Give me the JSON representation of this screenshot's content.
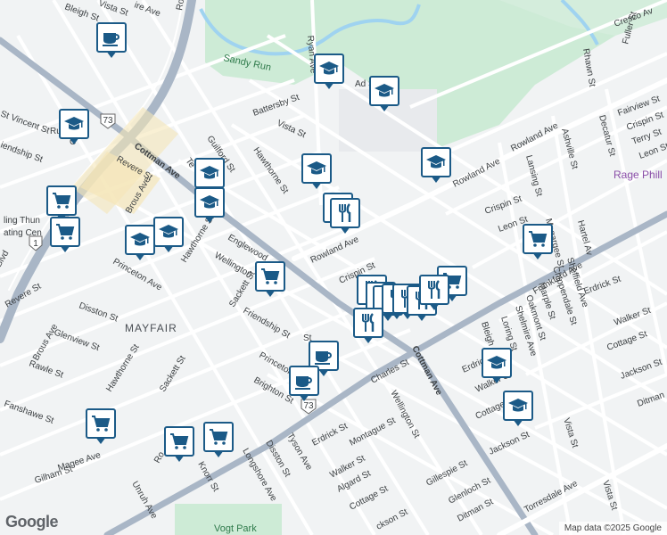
{
  "map": {
    "neighborhood": "MAYFAIR",
    "park_labels": {
      "sandy_run": "Sandy Run",
      "vogt_park": "Vogt Park"
    },
    "poi_labels": {
      "school": "Ad   School",
      "rage": "Rage Phill",
      "skating": "ling Thun",
      "skating2": "ating Cen"
    },
    "route_shields": {
      "us1": "1",
      "pa73a": "73",
      "pa73b": "73"
    },
    "streets": {
      "roosevelt_blvd": "Ro",
      "rhawn_st": "Rhawn St",
      "ryan_ave": "Ryan Ave",
      "cresco": "Cresco Av",
      "fuller_st": "Fuller St",
      "fairview_st": "Fairview St",
      "crispin_st_ne": "Crispin St",
      "terry_st": "Terry St",
      "leon_st_ne": "Leon St",
      "decatur_st": "Decatur St",
      "ashville_st": "Ashville St",
      "lansing_st": "Lansing St",
      "hartel_ave": "Hartel Av",
      "rowland_ave_ne": "Rowland Ave",
      "rowland_ave_mid": "Rowland Ave",
      "rowland_ave_c": "Rowland Ave",
      "crispin_st_c": "Crispin St",
      "leon_st_c": "Leon St",
      "megargee": "Megargee St",
      "frankford_ave": "Frankford Ave",
      "sheffield_ave": "Sheffield Ave",
      "chippendale_st": "Chippendale St",
      "marple_st": "Marple St",
      "oakmont_st": "Oakmont St",
      "shelmire_ave": "Shelmire Ave",
      "loring_st": "Loring St",
      "bleigh_ave_e": "Bleigh Av",
      "erdrick_st_e": "Erdrick St",
      "walker_st_e": "Walker St",
      "cottage_st_e": "Cottage St",
      "jackson_st_e": "Jackson St",
      "ditman_st_e": "Ditman",
      "leon_st_far": "Leon St",
      "vista_st_e": "Vista St",
      "vista_st_se": "Vista St",
      "torresdale_ave": "Torresdale Ave",
      "cottman_ave_nw": "Cottman Ave",
      "cottman_ave_se": "Cottman Ave",
      "battersby_st": "Battersby St",
      "vista_st_n": "Vista St",
      "guilford_st": "Guilford St",
      "hawthorne_st_n": "Hawthorne St",
      "teesdale": "Te",
      "englewood_st": "Englewood",
      "wellington_st_n": "Wellington",
      "hawthorne_st_w": "Hawthorne St",
      "sackett_st_n": "Sackett St",
      "friendship_st_c": "Friendship St",
      "princeton_ave_c": "Princeton",
      "brighton_st": "Brighton St",
      "revere_st_n": "Revere St",
      "brous_ave_n": "Brous Ave",
      "princeton_ave_w": "Princeton Ave",
      "st_vincent_st": "St Vincent St",
      "friendship_st_w": "iendship St",
      "revere_st_w": "Revere St",
      "brous_ave_w": "Brous Ave",
      "disston_st_w": "Disston St",
      "glenview_st": "Glenview St",
      "rawle_st": "Rawle St",
      "hawthorne_st_s": "Hawthorne St",
      "sackett_st_s": "Sackett St",
      "fanshawe_st": "Fanshawe St",
      "magee_ave": "Magee Ave",
      "gilham_st": "Gilham St",
      "unruh_ave": "Unruh Ave",
      "knorr_st": "Knorr St",
      "longshore_ave": "Longshore Ave",
      "disston_st_s": "Disston St",
      "tyson_ave": "Tyson Ave",
      "erdrick_st_s": "Erdrick St",
      "walker_st_s": "Walker St",
      "algard_st": "Algard St",
      "cottage_st_s": "Cottage St",
      "jackson_st_s": "ckson St",
      "montague_st": "Montague St",
      "wellington_st_s": "Wellington St",
      "charles_st": "Charles St",
      "gillespie_st": "Gillespie St",
      "glenloch_st": "Glenloch St",
      "ditman_st_s": "Ditman St",
      "bleigh_st_nw": "Bleigh St",
      "vista_st_nw": "Vista St",
      "blvd": "Blvd",
      "cr_st": "Crispin St",
      "rowla": "Ro",
      "ro_s": "Ro",
      "c_label": "C",
      "ru_label": "Ru",
      "st_label": "St",
      "ire_ave": "ire Ave",
      "erdrick_east": "Erdrick St"
    },
    "attribution": "Map data ©2025 Google",
    "logo": "Google",
    "markers": [
      {
        "type": "coffee",
        "icon": "coffee-cup-icon"
      },
      {
        "type": "school",
        "icon": "graduation-cap-icon"
      },
      {
        "type": "school",
        "icon": "graduation-cap-icon"
      },
      {
        "type": "school",
        "icon": "graduation-cap-icon"
      },
      {
        "type": "school",
        "icon": "graduation-cap-icon"
      },
      {
        "type": "school",
        "icon": "graduation-cap-icon"
      },
      {
        "type": "school",
        "icon": "graduation-cap-icon"
      },
      {
        "type": "school",
        "icon": "graduation-cap-icon"
      },
      {
        "type": "school",
        "icon": "graduation-cap-icon"
      },
      {
        "type": "school",
        "icon": "graduation-cap-icon"
      },
      {
        "type": "school",
        "icon": "graduation-cap-icon"
      },
      {
        "type": "school",
        "icon": "graduation-cap-icon"
      },
      {
        "type": "shopping",
        "icon": "shopping-cart-icon"
      },
      {
        "type": "shopping",
        "icon": "shopping-cart-icon"
      },
      {
        "type": "shopping",
        "icon": "shopping-cart-icon"
      },
      {
        "type": "shopping",
        "icon": "shopping-cart-icon"
      },
      {
        "type": "shopping",
        "icon": "shopping-cart-icon"
      },
      {
        "type": "shopping",
        "icon": "shopping-cart-icon"
      },
      {
        "type": "shopping",
        "icon": "shopping-cart-icon"
      },
      {
        "type": "shopping",
        "icon": "shopping-cart-icon"
      },
      {
        "type": "restaurant",
        "icon": "fork-knife-icon"
      },
      {
        "type": "restaurant",
        "icon": "fork-knife-icon"
      },
      {
        "type": "restaurant",
        "icon": "fork-knife-icon"
      },
      {
        "type": "restaurant",
        "icon": "fork-knife-icon"
      },
      {
        "type": "restaurant",
        "icon": "fork-knife-icon"
      },
      {
        "type": "restaurant",
        "icon": "fork-knife-icon"
      },
      {
        "type": "restaurant",
        "icon": "fork-knife-icon"
      },
      {
        "type": "restaurant",
        "icon": "fork-knife-icon"
      },
      {
        "type": "restaurant",
        "icon": "fork-knife-icon"
      },
      {
        "type": "restaurant",
        "icon": "fork-knife-icon"
      },
      {
        "type": "coffee",
        "icon": "coffee-cup-icon"
      },
      {
        "type": "coffee",
        "icon": "coffee-cup-icon"
      }
    ]
  }
}
